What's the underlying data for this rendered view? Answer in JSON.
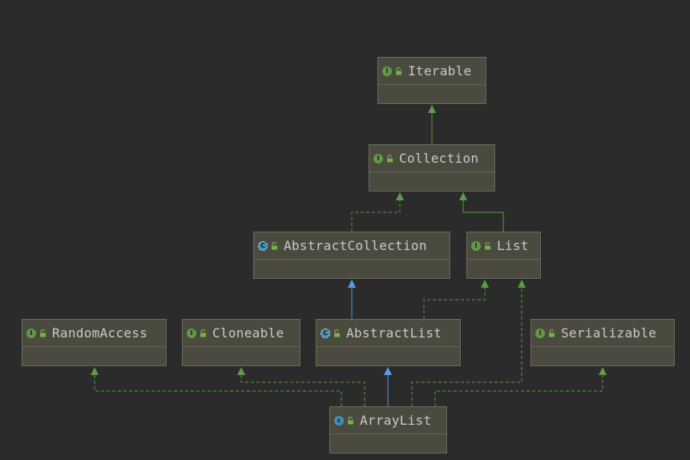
{
  "diagram": {
    "title": "",
    "nodes": [
      {
        "id": "iterable",
        "name": "Iterable",
        "kind": "interface",
        "kind_glyph": "I"
      },
      {
        "id": "collection",
        "name": "Collection",
        "kind": "interface",
        "kind_glyph": "I"
      },
      {
        "id": "abstractcollection",
        "name": "AbstractCollection",
        "kind": "abstract-class",
        "kind_glyph": "C"
      },
      {
        "id": "list",
        "name": "List",
        "kind": "interface",
        "kind_glyph": "I"
      },
      {
        "id": "randomaccess",
        "name": "RandomAccess",
        "kind": "interface",
        "kind_glyph": "I"
      },
      {
        "id": "cloneable",
        "name": "Cloneable",
        "kind": "interface",
        "kind_glyph": "I"
      },
      {
        "id": "abstractlist",
        "name": "AbstractList",
        "kind": "abstract-class",
        "kind_glyph": "C"
      },
      {
        "id": "serializable",
        "name": "Serializable",
        "kind": "interface",
        "kind_glyph": "I"
      },
      {
        "id": "arraylist",
        "name": "ArrayList",
        "kind": "class",
        "kind_glyph": "c"
      }
    ],
    "edges": [
      {
        "from": "collection",
        "to": "iterable",
        "type": "extends-interface"
      },
      {
        "from": "abstractcollection",
        "to": "collection",
        "type": "implements"
      },
      {
        "from": "list",
        "to": "collection",
        "type": "extends-interface"
      },
      {
        "from": "abstractlist",
        "to": "abstractcollection",
        "type": "extends-class"
      },
      {
        "from": "abstractlist",
        "to": "list",
        "type": "implements"
      },
      {
        "from": "arraylist",
        "to": "abstractlist",
        "type": "extends-class"
      },
      {
        "from": "arraylist",
        "to": "randomaccess",
        "type": "implements"
      },
      {
        "from": "arraylist",
        "to": "cloneable",
        "type": "implements"
      },
      {
        "from": "arraylist",
        "to": "list",
        "type": "implements"
      },
      {
        "from": "arraylist",
        "to": "serializable",
        "type": "implements"
      }
    ],
    "colors": {
      "background": "#2b2b2b",
      "node_fill": "#4b4a3e",
      "interface_edge": "#5f9a48",
      "class_edge": "#5a9ae6",
      "label": "#c9c9c9"
    },
    "icons": {
      "interface": "interface-icon",
      "class": "class-icon",
      "abstract-class": "abstract-class-icon",
      "visibility": "public-lock-icon"
    }
  }
}
